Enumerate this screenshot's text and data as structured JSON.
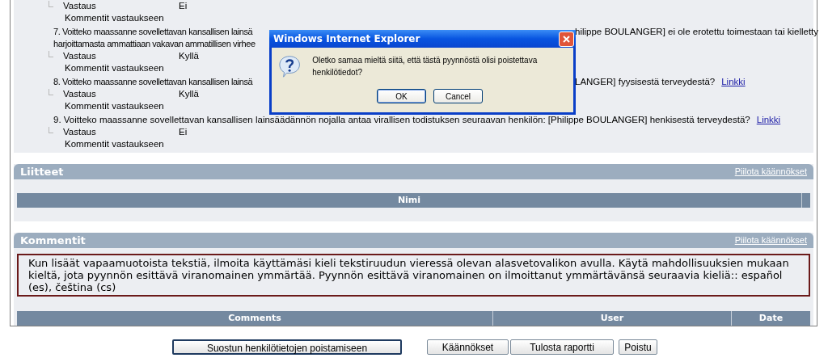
{
  "answers_section": {
    "items": [
      {
        "answer_label": "Vastaus",
        "answer": "Ei",
        "comment_label": "Kommentit vastaukseen"
      },
      {
        "question": [
          {
            "before": "7. Voitteko maassanne sovellettavan kansallisen lainsä",
            "after": "hilippe BOULANGER] ei ole erotettu toimestaan tai kielletty"
          },
          {
            "before": "harjoittamasta ammattiaan vakavan ammatillisen virhee"
          }
        ],
        "answer_label": "Vastaus",
        "answer": "Kyllä",
        "comment_label": "Kommentit vastaukseen"
      },
      {
        "question": [
          {
            "before": "8. Voitteko maassanne sovellettavan kansallisen lainsä",
            "after": "LANGER] fyysisestä terveydestä?",
            "link": "Linkki"
          }
        ],
        "answer_label": "Vastaus",
        "answer": "Kyllä",
        "comment_label": "Kommentit vastaukseen"
      },
      {
        "question": [
          {
            "before": "9. Voitteko maassanne sovellettavan kansallisen lainsäädännön nojalla antaa virallisen todistuksen seuraavan henkilön: [Philippe BOULANGER] henkisestä terveydestä?",
            "link": "Linkki"
          }
        ],
        "answer_label": "Vastaus",
        "answer": "Ei",
        "comment_label": "Kommentit vastaukseen"
      }
    ]
  },
  "dialog": {
    "title": "Windows Internet Explorer",
    "message": "Oletko samaa mieltä siitä, että tästä pyynnöstä olisi poistettava henkilötiedot?",
    "buttons": [
      {
        "label": "OK",
        "focused": true
      },
      {
        "label": "Cancel",
        "focused": false
      }
    ]
  },
  "attachments": {
    "title": "Liitteet",
    "toggle_link": "Piilota käännökset",
    "columns": [
      "Nimi"
    ]
  },
  "comments": {
    "title": "Kommentit",
    "toggle_link": "Piilota käännökset",
    "notice": "Kun lisäät vapaamuotoista tekstiä, ilmoita käyttämäsi kieli tekstiruudun vieressä olevan alasvetovalikon avulla. Käytä mahdollisuuksien mukaan kieltä, jota pyynnön esittävä viranomainen ymmärtää. Pyynnön esittävä viranomainen on ilmoittanut ymmärtävänsä seuraavia kieliä:: español (es), čeština (cs)",
    "columns": [
      "Comments",
      "User",
      "Date"
    ]
  },
  "buttons": [
    {
      "label": "Suostun henkilötietojen poistamiseen",
      "focused": true
    },
    {
      "label": "Käännökset",
      "focused": false
    },
    {
      "label": "Tulosta raportti",
      "focused": false
    },
    {
      "label": "Poistu",
      "focused": false
    }
  ]
}
